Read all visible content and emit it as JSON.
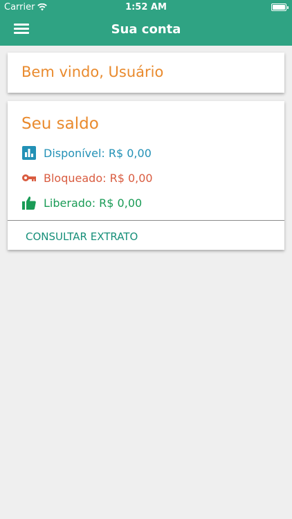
{
  "status_bar": {
    "carrier": "Carrier",
    "time": "1:52 AM"
  },
  "nav": {
    "title": "Sua conta",
    "menu_icon": "hamburger-menu-icon"
  },
  "welcome": {
    "text": "Bem vindo, Usuário"
  },
  "balance": {
    "title": "Seu saldo",
    "available": {
      "label": "Disponível: R$ 0,00",
      "icon": "bar-chart-icon",
      "color": "#2391b6"
    },
    "blocked": {
      "label": "Bloqueado: R$ 0,00",
      "icon": "key-icon",
      "color": "#d95c40"
    },
    "released": {
      "label": "Liberado: R$ 0,00",
      "icon": "thumbs-up-icon",
      "color": "#1a9b56"
    },
    "action_label": "CONSULTAR EXTRATO"
  },
  "colors": {
    "primary": "#2fa383",
    "accent": "#e98a2d",
    "background": "#efefef"
  }
}
